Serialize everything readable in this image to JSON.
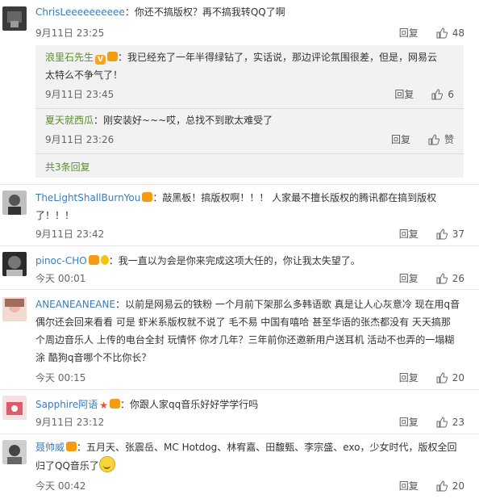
{
  "comments": [
    {
      "nick": "ChrisLeeeeeeeeee",
      "body": "：你还不搞版权？再不搞我转QQ了啊",
      "time": "9月11日 23:25",
      "reply": "回复",
      "likes": "48"
    },
    {
      "nick": "TheLightShallBurnYou",
      "body": "：敲黑板！搞版权啊！！！ 人家最不擅长版权的腾讯都在搞到版权",
      "body2": "了！！！",
      "time": "9月11日 23:42",
      "reply": "回复",
      "likes": "37"
    },
    {
      "nick": "pinoc-CHO",
      "body": "：我一直以为会是你来完成这项大任的，你让我太失望了。",
      "time": "今天 00:01",
      "reply": "回复",
      "likes": "26"
    },
    {
      "nick": "ANEANEANEANE",
      "body": "：以前是网易云的铁粉 一个月前下架那么多韩语歌 真是让人心灰意冷 现在用q音",
      "body2": "偶尔还会回来看看 可是 虾米系版权就不说了 毛不易 中国有嘻哈 甚至华语的张杰都没有 天天搞那",
      "body3": "个周边音乐人 上传的电台全封 玩情怀 你才几年？三年前你还邀新用户送耳机 活动不也弄的一塌糊",
      "body4": "涂 酷狗q音哪个不比你长？",
      "time": "今天 00:15",
      "reply": "回复",
      "likes": "20"
    },
    {
      "nick": "Sapphire阿语",
      "body": "：你跟人家qq音乐好好学学行吗",
      "time": "9月11日 23:12",
      "reply": "回复",
      "likes": "23"
    },
    {
      "nick": "聂帅威",
      "body": "：五月天、张震岳、MC Hotdog、林宥嘉、田馥甄、李宗盛、exo，少女时代，版权全回",
      "body2": "归了QQ音乐了",
      "time": "今天 00:42",
      "reply": "回复",
      "likes": "20"
    }
  ],
  "replies": [
    {
      "nick": "浪里石先生",
      "body": "：我已经充了一年半得绿钻了，实话说，那边评论氛围很差，但是，网易云",
      "body2": "太特么不争气了！",
      "time": "9月11日 23:45",
      "reply": "回复",
      "likes": "6"
    },
    {
      "nick": "夏天就西瓜",
      "body": "：刚安装好~~~哎，总找不到歌太难受了",
      "time": "9月11日 23:26",
      "reply": "回复",
      "likes": "赞"
    }
  ],
  "more_replies": "共3条回复",
  "colors": {
    "link_blue": "#3b7cb8",
    "link_green": "#5a8c2f",
    "reply_bg": "#f2f2f2"
  }
}
